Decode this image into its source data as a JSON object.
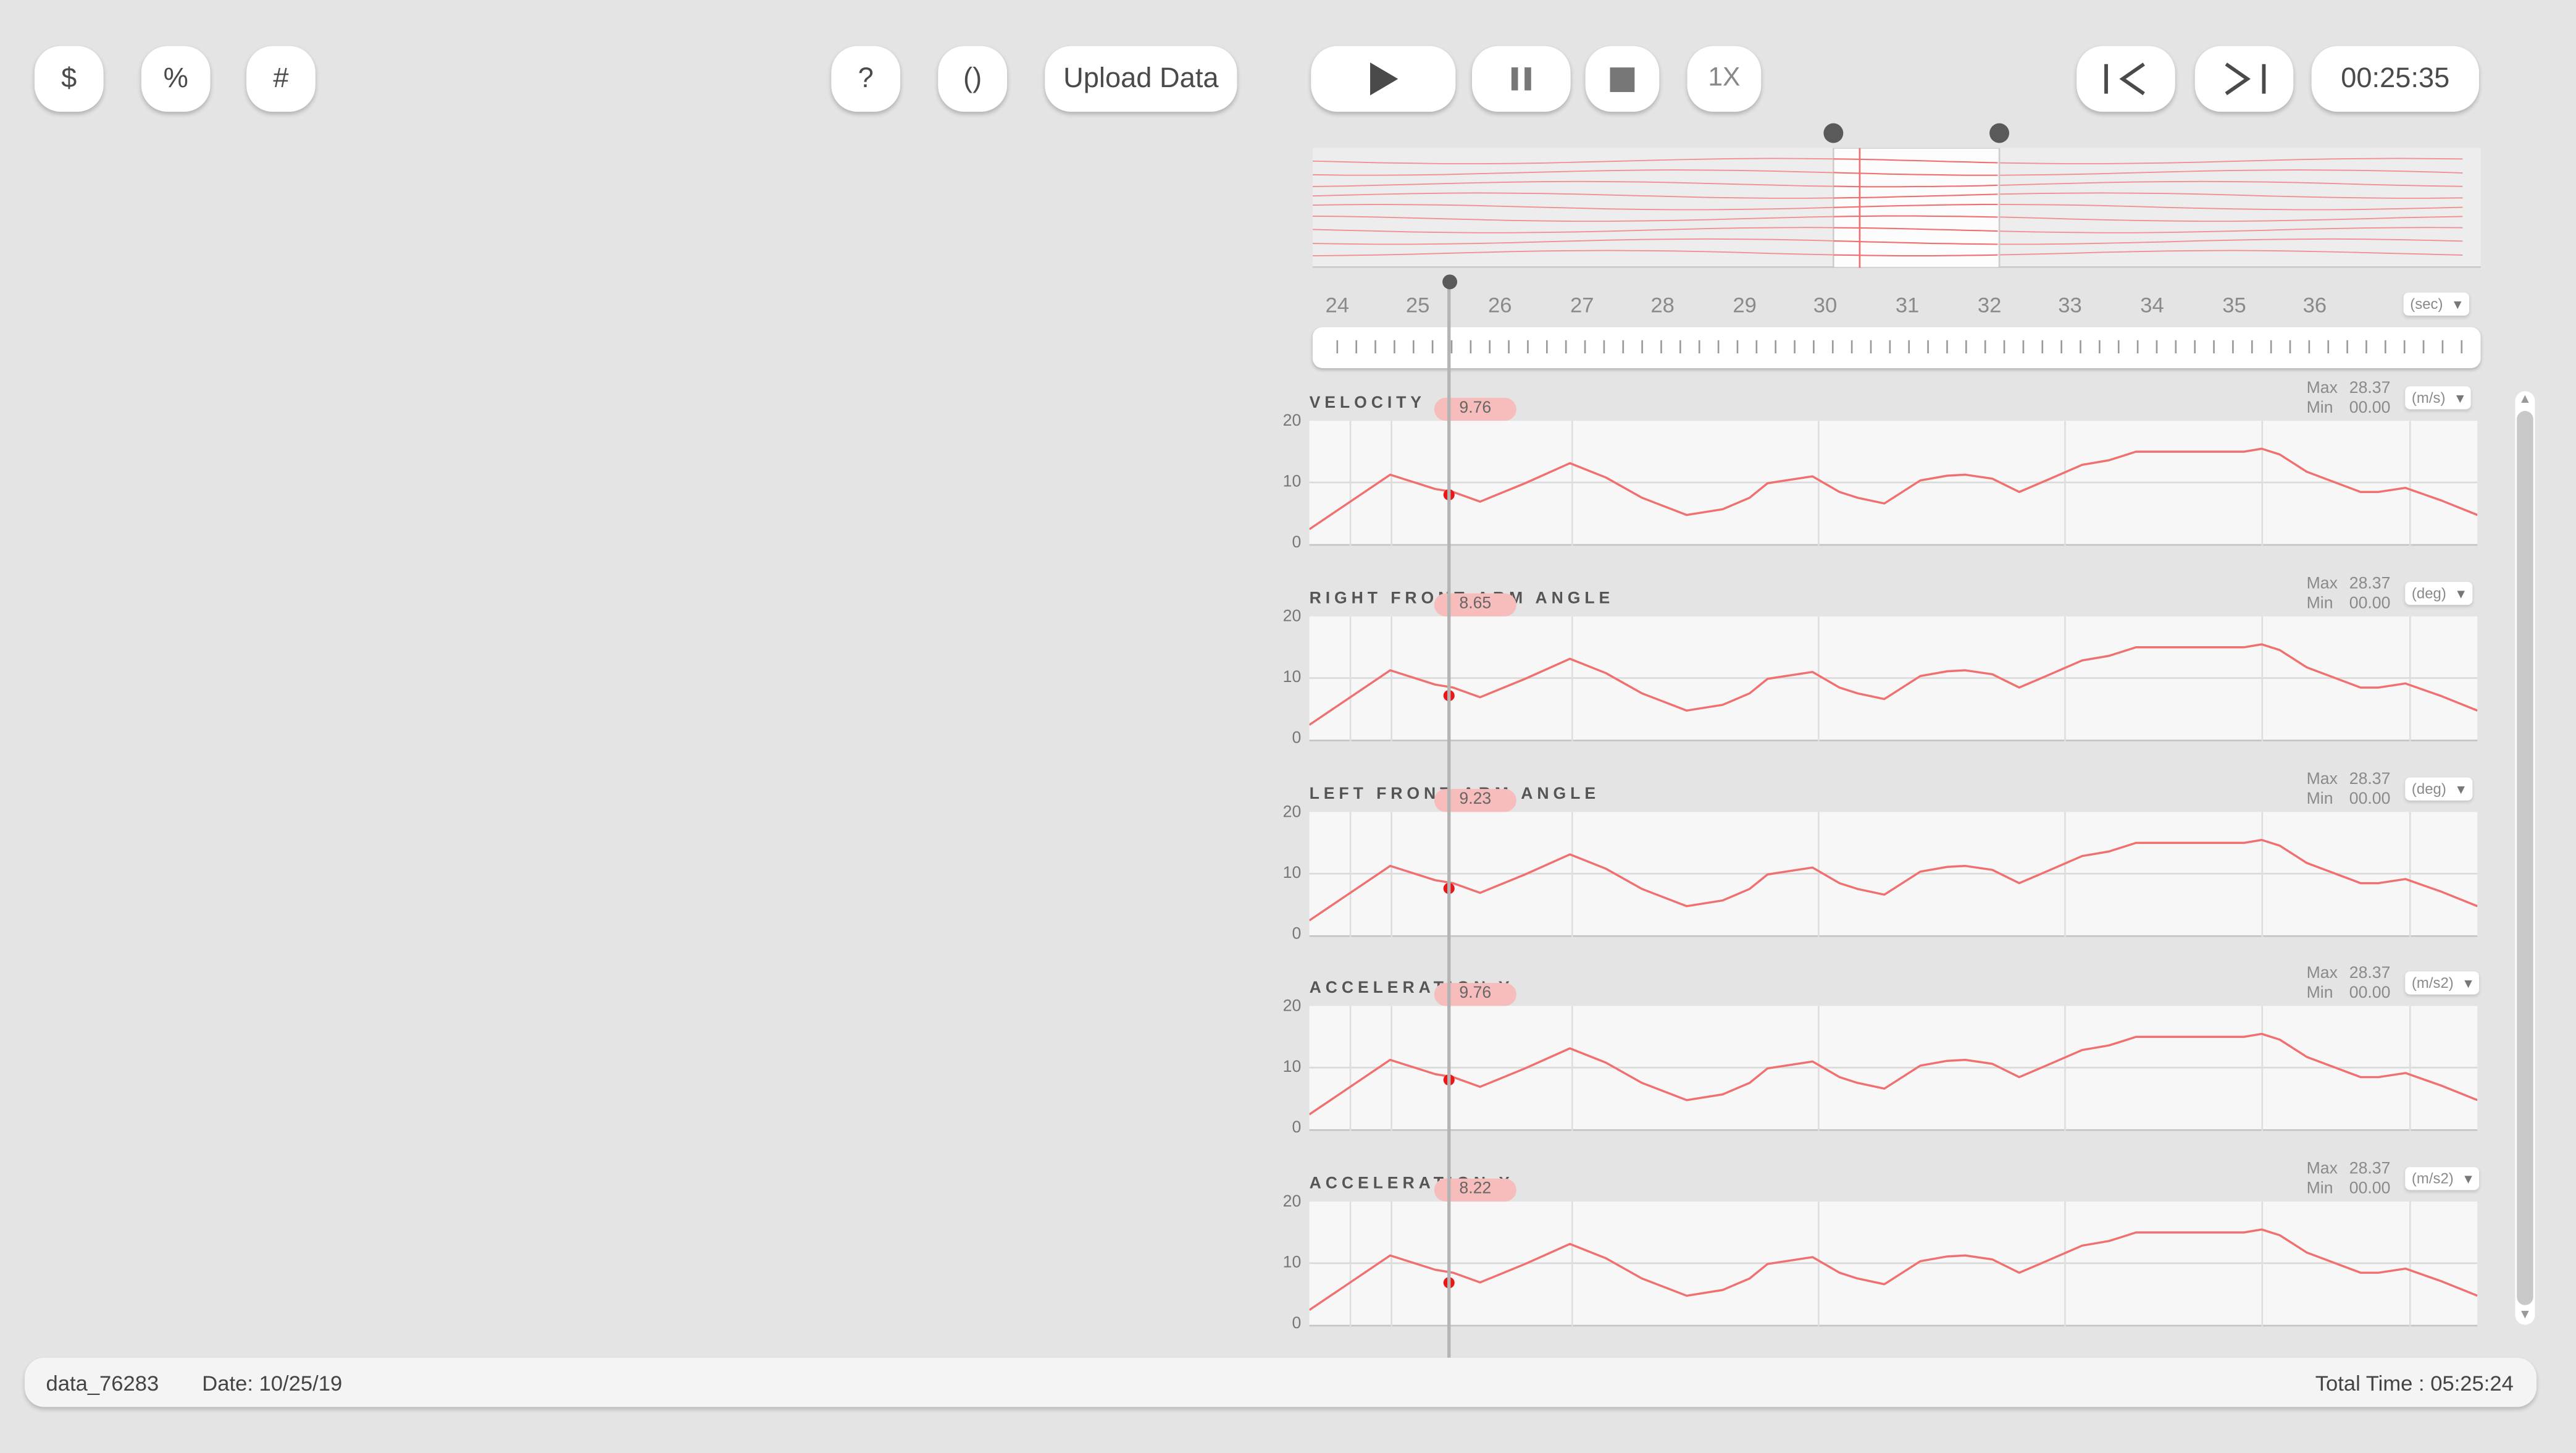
{
  "toolbar": {
    "dollar": "$",
    "percent": "%",
    "hash": "#",
    "help": "?",
    "paren": "()",
    "upload": "Upload Data",
    "speed": "1X",
    "time": "00:25:35"
  },
  "timeline": {
    "labels": [
      "24",
      "25",
      "26",
      "27",
      "28",
      "29",
      "30",
      "31",
      "32",
      "33",
      "34",
      "35",
      "36"
    ],
    "unit": "(sec)"
  },
  "charts": [
    {
      "title": "VELOCITY",
      "unit": "(m/s)",
      "max_label": "Max",
      "max": "28.37",
      "min_label": "Min",
      "min": "00.00",
      "value": "9.76",
      "y_ticks": [
        "20",
        "10",
        "0"
      ]
    },
    {
      "title": "RIGHT FRONT ARM ANGLE",
      "unit": "(deg)",
      "max_label": "Max",
      "max": "28.37",
      "min_label": "Min",
      "min": "00.00",
      "value": "8.65",
      "y_ticks": [
        "20",
        "10",
        "0"
      ]
    },
    {
      "title": "LEFT FRONT ARM ANGLE",
      "unit": "(deg)",
      "max_label": "Max",
      "max": "28.37",
      "min_label": "Min",
      "min": "00.00",
      "value": "9.23",
      "y_ticks": [
        "20",
        "10",
        "0"
      ]
    },
    {
      "title": "ACCELERATION Y",
      "unit": "(m/s2)",
      "max_label": "Max",
      "max": "28.37",
      "min_label": "Min",
      "min": "00.00",
      "value": "9.76",
      "y_ticks": [
        "20",
        "10",
        "0"
      ]
    },
    {
      "title": "ACCELERATION X",
      "unit": "(m/s2)",
      "max_label": "Max",
      "max": "28.37",
      "min_label": "Min",
      "min": "00.00",
      "value": "8.22",
      "y_ticks": [
        "20",
        "10",
        "0"
      ]
    }
  ],
  "footer": {
    "file": "data_76283",
    "date": "Date: 10/25/19",
    "total": "Total Time : 05:25:24"
  },
  "colors": {
    "accent": "#f07070",
    "marker": "#e81818",
    "badge": "#f7bcbc"
  },
  "chart_data": [
    {
      "type": "line",
      "title": "VELOCITY",
      "ylim": [
        0,
        20
      ],
      "x": [
        24,
        24.9,
        25.4,
        25.6,
        25.9,
        26.4,
        26.9,
        27.3,
        27.7,
        28.2,
        28.6,
        28.9,
        29.1,
        29.3,
        29.6,
        29.9,
        30.1,
        30.4,
        30.8,
        31.1,
        31.3,
        31.6,
        31.9,
        32.2,
        32.6,
        32.9,
        33.2,
        34.4,
        34.6,
        34.8,
        35.1,
        35.7,
        35.9,
        36.2,
        36.6,
        37.0
      ],
      "y": [
        2,
        11.5,
        9,
        8.5,
        6.8,
        10,
        13.5,
        11,
        7.5,
        4.5,
        5.5,
        7.5,
        10,
        10.5,
        11.2,
        8.5,
        7.5,
        6.5,
        10.5,
        11.3,
        11.5,
        10.8,
        8.5,
        10.5,
        13.2,
        14,
        15.5,
        15.5,
        16,
        15,
        12,
        8.5,
        8.5,
        9.2,
        7,
        4.5
      ]
    },
    {
      "type": "line",
      "title": "RIGHT FRONT ARM ANGLE",
      "ylim": [
        0,
        20
      ],
      "x": [
        24,
        24.9,
        25.4,
        25.6,
        25.9,
        26.4,
        26.9,
        27.3,
        27.7,
        28.2,
        28.6,
        28.9,
        29.1,
        29.3,
        29.6,
        29.9,
        30.1,
        30.4,
        30.8,
        31.1,
        31.3,
        31.6,
        31.9,
        32.2,
        32.6,
        32.9,
        33.2,
        34.4,
        34.6,
        34.8,
        35.1,
        35.7,
        35.9,
        36.2,
        36.6,
        37.0
      ],
      "y": [
        2,
        11.5,
        9,
        8.5,
        6.8,
        10,
        13.5,
        11,
        7.5,
        4.5,
        5.5,
        7.5,
        10,
        10.5,
        11.2,
        8.5,
        7.5,
        6.5,
        10.5,
        11.3,
        11.5,
        10.8,
        8.5,
        10.5,
        13.2,
        14,
        15.5,
        15.5,
        16,
        15,
        12,
        8.5,
        8.5,
        9.2,
        7,
        4.5
      ]
    },
    {
      "type": "line",
      "title": "LEFT FRONT ARM ANGLE",
      "ylim": [
        0,
        20
      ],
      "x": [
        24,
        24.9,
        25.4,
        25.6,
        25.9,
        26.4,
        26.9,
        27.3,
        27.7,
        28.2,
        28.6,
        28.9,
        29.1,
        29.3,
        29.6,
        29.9,
        30.1,
        30.4,
        30.8,
        31.1,
        31.3,
        31.6,
        31.9,
        32.2,
        32.6,
        32.9,
        33.2,
        34.4,
        34.6,
        34.8,
        35.1,
        35.7,
        35.9,
        36.2,
        36.6,
        37.0
      ],
      "y": [
        2,
        11.5,
        9,
        8.5,
        6.8,
        10,
        13.5,
        11,
        7.5,
        4.5,
        5.5,
        7.5,
        10,
        10.5,
        11.2,
        8.5,
        7.5,
        6.5,
        10.5,
        11.3,
        11.5,
        10.8,
        8.5,
        10.5,
        13.2,
        14,
        15.5,
        15.5,
        16,
        15,
        12,
        8.5,
        8.5,
        9.2,
        7,
        4.5
      ]
    },
    {
      "type": "line",
      "title": "ACCELERATION Y",
      "ylim": [
        0,
        20
      ],
      "x": [
        24,
        24.9,
        25.4,
        25.6,
        25.9,
        26.4,
        26.9,
        27.3,
        27.7,
        28.2,
        28.6,
        28.9,
        29.1,
        29.3,
        29.6,
        29.9,
        30.1,
        30.4,
        30.8,
        31.1,
        31.3,
        31.6,
        31.9,
        32.2,
        32.6,
        32.9,
        33.2,
        34.4,
        34.6,
        34.8,
        35.1,
        35.7,
        35.9,
        36.2,
        36.6,
        37.0
      ],
      "y": [
        2,
        11.5,
        9,
        8.5,
        6.8,
        10,
        13.5,
        11,
        7.5,
        4.5,
        5.5,
        7.5,
        10,
        10.5,
        11.2,
        8.5,
        7.5,
        6.5,
        10.5,
        11.3,
        11.5,
        10.8,
        8.5,
        10.5,
        13.2,
        14,
        15.5,
        15.5,
        16,
        15,
        12,
        8.5,
        8.5,
        9.2,
        7,
        4.5
      ]
    },
    {
      "type": "line",
      "title": "ACCELERATION X",
      "ylim": [
        0,
        20
      ],
      "x": [
        24,
        24.9,
        25.4,
        25.6,
        25.9,
        26.4,
        26.9,
        27.3,
        27.7,
        28.2,
        28.6,
        28.9,
        29.1,
        29.3,
        29.6,
        29.9,
        30.1,
        30.4,
        30.8,
        31.1,
        31.3,
        31.6,
        31.9,
        32.2,
        32.6,
        32.9,
        33.2,
        34.4,
        34.6,
        34.8,
        35.1,
        35.7,
        35.9,
        36.2,
        36.6,
        37.0
      ],
      "y": [
        2,
        11.5,
        9,
        8.5,
        6.8,
        10,
        13.5,
        11,
        7.5,
        4.5,
        5.5,
        7.5,
        10,
        10.5,
        11.2,
        8.5,
        7.5,
        6.5,
        10.5,
        11.3,
        11.5,
        10.8,
        8.5,
        10.5,
        13.2,
        14,
        15.5,
        15.5,
        16,
        15,
        12,
        8.5,
        8.5,
        9.2,
        7,
        4.5
      ]
    }
  ]
}
